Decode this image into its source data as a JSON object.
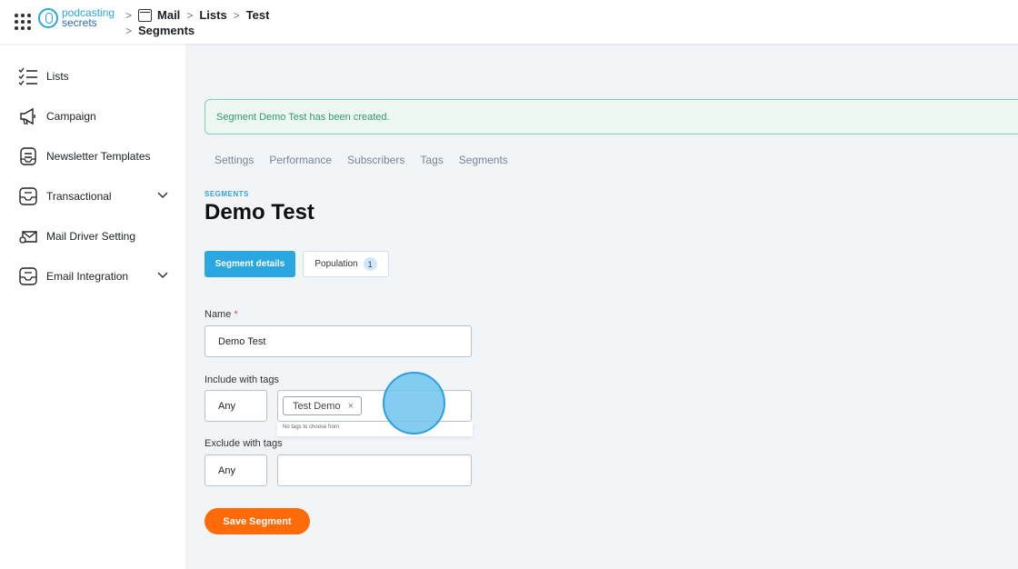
{
  "brand": {
    "line1": "podcasting",
    "line2": "secrets"
  },
  "breadcrumb": {
    "item1": "Mail",
    "item2": "Lists",
    "item3": "Test",
    "item4": "Segments"
  },
  "sidebar": {
    "items": [
      {
        "label": "Lists",
        "icon": "checklist-icon"
      },
      {
        "label": "Campaign",
        "icon": "megaphone-icon"
      },
      {
        "label": "Newsletter Templates",
        "icon": "newsletter-icon"
      },
      {
        "label": "Transactional",
        "icon": "inbox-icon"
      },
      {
        "label": "Mail Driver Setting",
        "icon": "mail-settings-icon"
      },
      {
        "label": "Email Integration",
        "icon": "inbox-icon"
      }
    ]
  },
  "alert": {
    "text": "Segment Demo Test has been created."
  },
  "tabs": [
    "Settings",
    "Performance",
    "Subscribers",
    "Tags",
    "Segments"
  ],
  "segment": {
    "eyebrow": "SEGMENTS",
    "title": "Demo Test",
    "details_button": "Segment details",
    "population_button": "Population",
    "population_count": "1"
  },
  "form": {
    "name_label": "Name",
    "required_mark": "*",
    "name_value": "Demo Test",
    "include_label": "Include with tags",
    "include_mode": "Any",
    "include_tag": "Test Demo",
    "tag_remove": "×",
    "no_tags_hint": "No tags to choose from",
    "exclude_label": "Exclude with tags",
    "exclude_mode": "Any",
    "save_button": "Save Segment"
  }
}
